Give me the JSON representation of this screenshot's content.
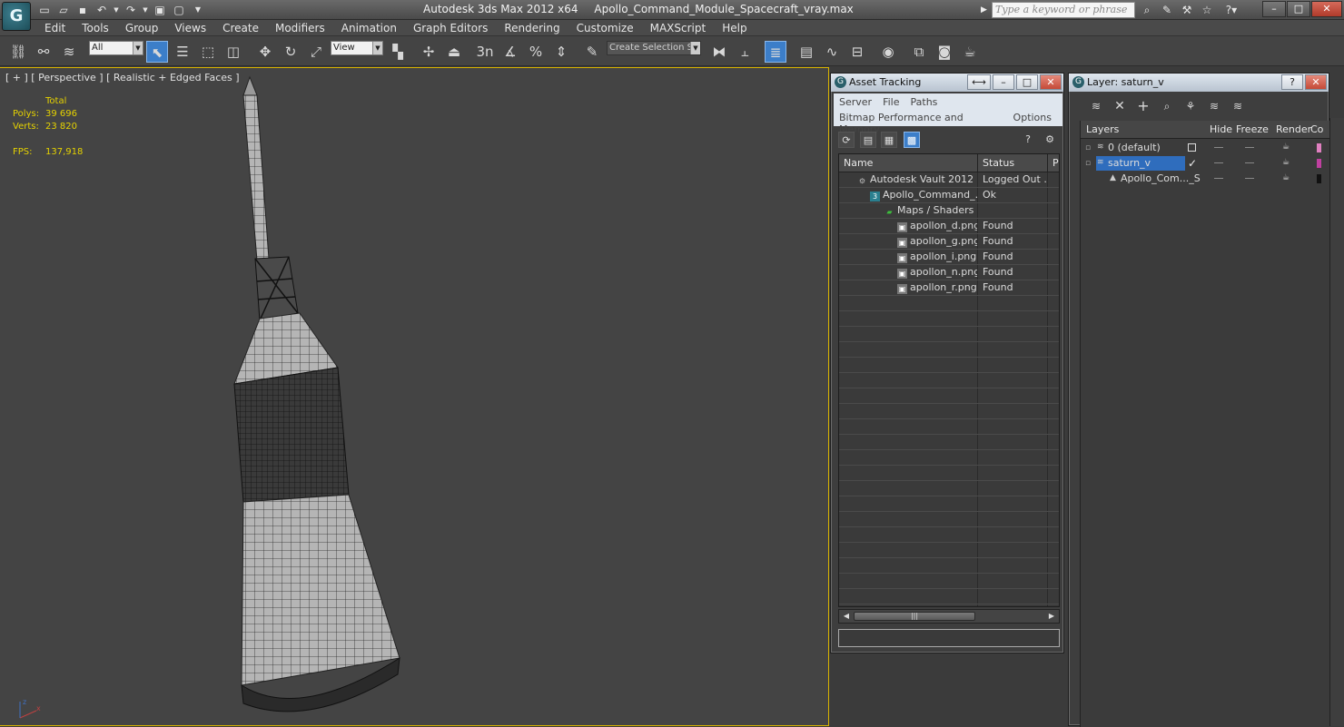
{
  "app": {
    "logo": "G",
    "title": "Autodesk 3ds Max  2012 x64",
    "file": "Apollo_Command_Module_Spacecraft_vray.max",
    "search_placeholder": "Type a keyword or phrase"
  },
  "menu": [
    "Edit",
    "Tools",
    "Group",
    "Views",
    "Create",
    "Modifiers",
    "Animation",
    "Graph Editors",
    "Rendering",
    "Customize",
    "MAXScript",
    "Help"
  ],
  "toolbar": {
    "selection_filter": "All",
    "ref_coord": "View",
    "named_selection": "Create Selection Se",
    "snap_label": "3n"
  },
  "viewport": {
    "label": "[ + ] [ Perspective ] [ Realistic + Edged Faces ]",
    "stats_header": "Total",
    "polys_label": "Polys:",
    "polys": "39 696",
    "verts_label": "Verts:",
    "verts": "23 820",
    "fps_label": "FPS:",
    "fps": "137,918",
    "axis_x": "x",
    "axis_z": "z"
  },
  "asset_tracking": {
    "title": "Asset Tracking",
    "menu_row1": [
      "Server",
      "File",
      "Paths"
    ],
    "menu_row2": [
      "Bitmap Performance and Memory",
      "Options"
    ],
    "columns": [
      "Name",
      "Status",
      "P"
    ],
    "rows": [
      {
        "name": "Autodesk Vault 2012",
        "status": "Logged Out ...",
        "icon": "vault-icon"
      },
      {
        "name": "Apollo_Command_...",
        "status": "Ok",
        "icon": "max-file-icon"
      },
      {
        "name": "Maps / Shaders",
        "status": "",
        "icon": "maps-icon"
      },
      {
        "name": "apollon_d.png",
        "status": "Found",
        "icon": "bitmap-icon"
      },
      {
        "name": "apollon_g.png",
        "status": "Found",
        "icon": "bitmap-icon"
      },
      {
        "name": "apollon_i.png",
        "status": "Found",
        "icon": "bitmap-icon"
      },
      {
        "name": "apollon_n.png",
        "status": "Found",
        "icon": "bitmap-icon"
      },
      {
        "name": "apollon_r.png",
        "status": "Found",
        "icon": "bitmap-icon"
      }
    ]
  },
  "layer_panel": {
    "title": "Layer: saturn_v",
    "columns": [
      "Layers",
      "Hide",
      "Freeze",
      "Render",
      "Co"
    ],
    "rows": [
      {
        "name": "0 (default)",
        "swatch": "#e080c0"
      },
      {
        "name": "saturn_v",
        "swatch": "#c040a0"
      },
      {
        "name": "Apollo_Com..._S",
        "swatch": "#111111"
      }
    ]
  },
  "colors": {
    "accent": "#3c7ec9",
    "viewport_border": "#d9b400",
    "stats_text": "#e5d200"
  }
}
